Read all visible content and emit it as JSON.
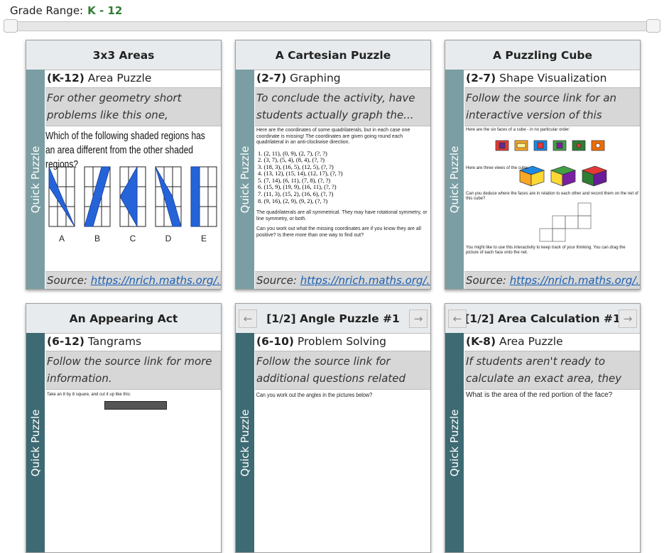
{
  "grade_range": {
    "label": "Grade Range:",
    "value": "K - 12"
  },
  "side_label": "Quick Puzzle",
  "source_label": "Source:",
  "cards": [
    {
      "title": "3x3 Areas",
      "grade": "(K-12)",
      "category": "Area Puzzle",
      "description": "For other geometry short problems like this one, includin...",
      "question": "Which of the following shaded regions has an area different from the other shaded regions?",
      "option_labels": [
        "A",
        "B",
        "C",
        "D",
        "E"
      ],
      "source_link": "https://nrich.maths.org/..."
    },
    {
      "title": "A Cartesian Puzzle",
      "grade": "(2-7)",
      "category": "Graphing",
      "description": "To conclude the activity, have students actually graph the...",
      "intro": "Here are the coordinates of some quadrilaterals, but in each case one coordinate is missing! The coordinates are given going round each quadrilateral in an anti-clockwise direction.",
      "coordinates": [
        "1. (2, 11), (0, 9), (2, 7), (?, ?)",
        "2. (3, 7), (5, 4), (8, 4), (?, ?)",
        "3. (18, 3), (16, 5), (12, 5), (?, ?)",
        "4. (13, 12), (15, 14), (12, 17), (?, ?)",
        "5. (7, 14), (6, 11), (7, 8), (?, ?)",
        "6. (15, 9), (19, 9), (16, 11), (?, ?)",
        "7. (11, 3), (15, 2), (16, 6), (?, ?)",
        "8. (9, 16), (2, 9), (9, 2), (?, ?)"
      ],
      "note1": "The quadrilaterals are all symmetrical. They may have rotational symmetry, or line symmetry, or both.",
      "note2": "Can you work out what the missing coordinates are if you know they are all positive? Is there more than one way to find out?",
      "source_link": "https://nrich.maths.org/..."
    },
    {
      "title": "A Puzzling Cube",
      "grade": "(2-7)",
      "category": "Shape Visualization",
      "description": "Follow the source link for an interactive version of this puzzle.",
      "text1": "Here are the six faces of a cube - in no particular order:",
      "text2": "Here are three views of the cube:",
      "text3": "Can you deduce where the faces are in relation to each other and record them on the net of this cube?",
      "text4": "You might like to use this interactivity to keep track of your thinking. You can drag the picture of each face onto the net.",
      "source_link": "https://nrich.maths.org/..."
    },
    {
      "title": "An Appearing Act",
      "grade": "(6-12)",
      "category": "Tangrams",
      "description": "Follow the source link for more information.",
      "text1": "Take an 8 by 8 square, and cut it up like this:"
    },
    {
      "title": "[1/2] Angle Puzzle #1",
      "grade": "(6-10)",
      "category": "Problem Solving",
      "description": "Follow the source link for additional questions related to...",
      "text1": "Can you work out the angles in the pictures below?",
      "prev": "←",
      "next": "→"
    },
    {
      "title": "[1/2] Area Calculation #1",
      "grade": "(K-8)",
      "category": "Area Puzzle",
      "description": "If students aren't ready to calculate an exact area, they ca...",
      "text1": "What is the area of the red portion of the face?",
      "prev": "←",
      "next": "→"
    }
  ],
  "colors": {
    "accent_green": "#2e7d32",
    "side_tab": "#7a9ea3",
    "side_tab_dark": "#3d6a73",
    "link": "#1a5fb4"
  }
}
